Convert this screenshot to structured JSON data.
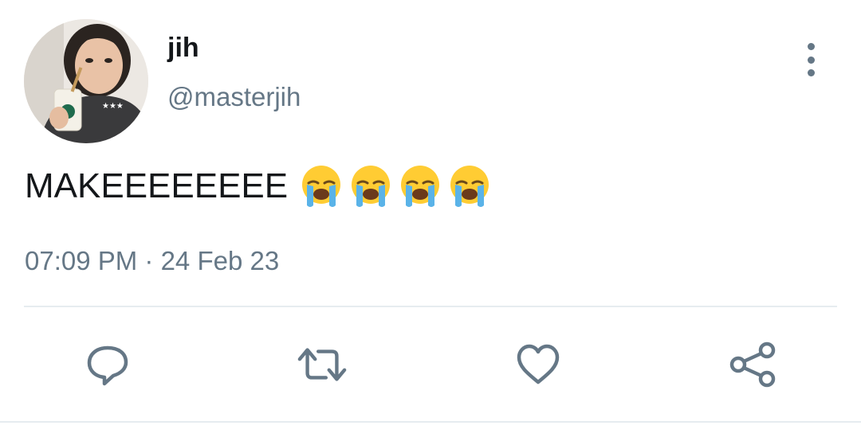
{
  "tweet": {
    "author": {
      "display_name": "jih",
      "handle": "@masterjih"
    },
    "text": "MAKEEEEEEEE",
    "emojis": [
      "loudly-crying-face",
      "loudly-crying-face",
      "loudly-crying-face",
      "loudly-crying-face"
    ],
    "timestamp": "07:09 PM · 24 Feb 23"
  },
  "actions": [
    {
      "name": "reply",
      "icon": "comment-icon"
    },
    {
      "name": "retweet",
      "icon": "retweet-icon"
    },
    {
      "name": "like",
      "icon": "heart-icon"
    },
    {
      "name": "share",
      "icon": "share-icon"
    }
  ],
  "colors": {
    "text": "#14171a",
    "secondary": "#657786",
    "divider": "#e6ecf0",
    "background": "#ffffff"
  }
}
